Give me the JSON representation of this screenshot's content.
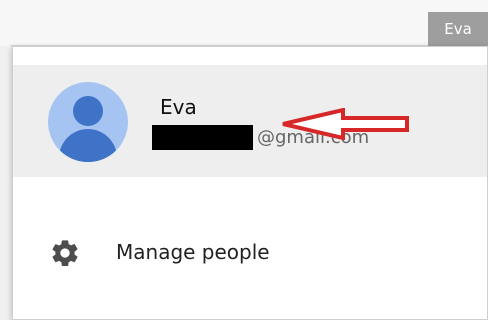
{
  "header": {
    "profile_name": "Eva"
  },
  "account": {
    "name": "Eva",
    "email_domain": "@gmail.com"
  },
  "menu": {
    "manage_people_label": "Manage people"
  },
  "colors": {
    "avatar_background": "#a6c4f2",
    "avatar_figure": "#3f73c8",
    "annotation_arrow": "#d62828"
  }
}
